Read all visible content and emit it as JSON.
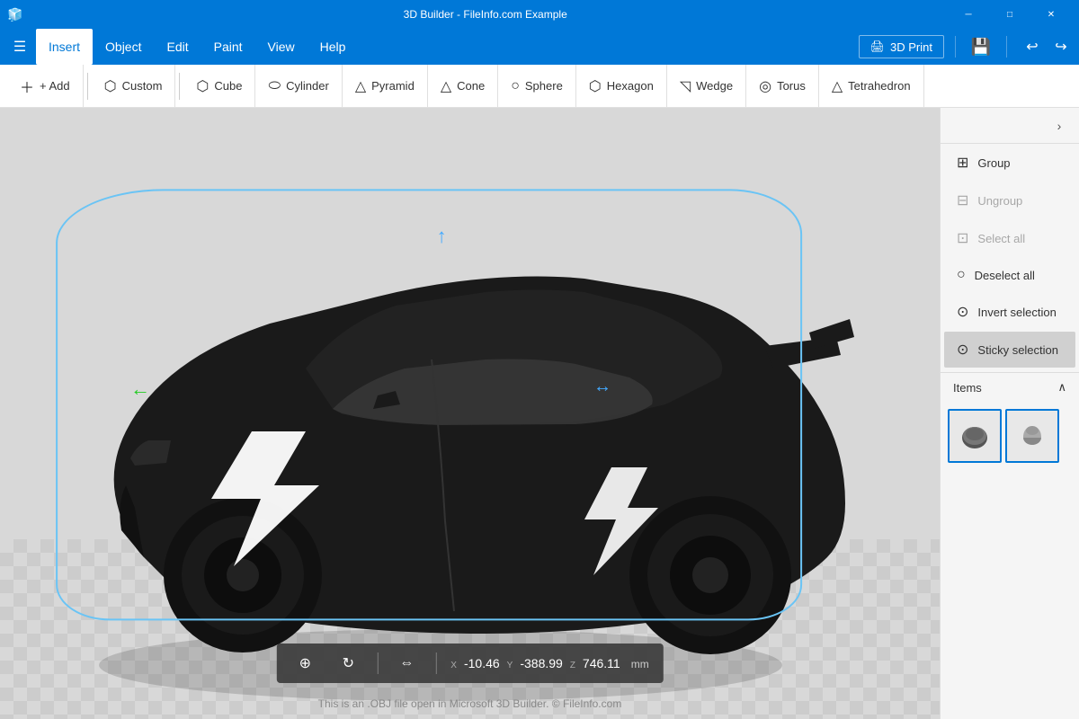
{
  "titlebar": {
    "title": "3D Builder - FileInfo.com Example",
    "minimize": "─",
    "maximize": "□",
    "close": "✕"
  },
  "menubar": {
    "hamburger": "☰",
    "items": [
      {
        "label": "Insert",
        "active": true
      },
      {
        "label": "Object",
        "active": false
      },
      {
        "label": "Edit",
        "active": false
      },
      {
        "label": "Paint",
        "active": false
      },
      {
        "label": "View",
        "active": false
      },
      {
        "label": "Help",
        "active": false
      }
    ],
    "print_label": "3D Print",
    "save_icon": "💾"
  },
  "toolbar": {
    "add_label": "+ Add",
    "custom_label": "Custom",
    "cube_label": "Cube",
    "cylinder_label": "Cylinder",
    "pyramid_label": "Pyramid",
    "cone_label": "Cone",
    "sphere_label": "Sphere",
    "hexagon_label": "Hexagon",
    "wedge_label": "Wedge",
    "torus_label": "Torus",
    "tetrahedron_label": "Tetrahedron"
  },
  "panel": {
    "collapse_icon": "›",
    "group_label": "Group",
    "ungroup_label": "Ungroup",
    "select_all_label": "Select all",
    "deselect_all_label": "Deselect all",
    "invert_label": "Invert selection",
    "sticky_label": "Sticky selection",
    "items_label": "Items",
    "items_collapse": "∧"
  },
  "statusbar": {
    "x_label": "X",
    "y_label": "Y",
    "z_label": "Z",
    "x_val": "-10.46",
    "y_val": "-388.99",
    "z_val": "746.11",
    "unit": "mm"
  },
  "bottom_text": "This is an .OBJ file open in Microsoft 3D Builder. © FileInfo.com"
}
